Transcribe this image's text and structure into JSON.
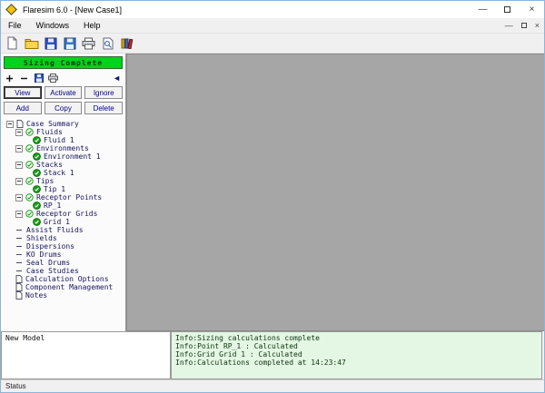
{
  "window": {
    "title": "Flaresim 6.0 - [New Case1]"
  },
  "menubar": {
    "items": [
      "File",
      "Windows",
      "Help"
    ]
  },
  "toolbar": {
    "icons": [
      "new-file",
      "open-folder",
      "save",
      "save-as",
      "print",
      "preview",
      "library"
    ]
  },
  "sidebar": {
    "status_banner": "Sizing Complete",
    "mini_toolbar": [
      "add",
      "remove",
      "save-mini",
      "print-mini"
    ],
    "collapse_arrow": "◄",
    "action_buttons": [
      "View",
      "Activate",
      "Ignore"
    ],
    "edit_buttons": [
      "Add",
      "Copy",
      "Delete"
    ],
    "tree": [
      {
        "label": "Case Summary",
        "level": 0,
        "icon": "doc",
        "expander": true
      },
      {
        "label": "Fluids",
        "level": 1,
        "icon": "check-open",
        "expander": true
      },
      {
        "label": "Fluid 1",
        "level": 2,
        "icon": "check-solid"
      },
      {
        "label": "Environments",
        "level": 1,
        "icon": "check-open",
        "expander": true
      },
      {
        "label": "Environment 1",
        "level": 2,
        "icon": "check-solid"
      },
      {
        "label": "Stacks",
        "level": 1,
        "icon": "check-open",
        "expander": true
      },
      {
        "label": "Stack 1",
        "level": 2,
        "icon": "check-solid"
      },
      {
        "label": "Tips",
        "level": 1,
        "icon": "check-open",
        "expander": true
      },
      {
        "label": "Tip 1",
        "level": 2,
        "icon": "check-solid"
      },
      {
        "label": "Receptor Points",
        "level": 1,
        "icon": "check-open",
        "expander": true
      },
      {
        "label": "RP_1",
        "level": 2,
        "icon": "check-solid"
      },
      {
        "label": "Receptor Grids",
        "level": 1,
        "icon": "check-open",
        "expander": true
      },
      {
        "label": "Grid 1",
        "level": 2,
        "icon": "check-solid"
      },
      {
        "label": "Assist Fluids",
        "level": 1,
        "icon": "dash"
      },
      {
        "label": "Shields",
        "level": 1,
        "icon": "dash"
      },
      {
        "label": "Dispersions",
        "level": 1,
        "icon": "dash"
      },
      {
        "label": "KO Drums",
        "level": 1,
        "icon": "dash"
      },
      {
        "label": "Seal Drums",
        "level": 1,
        "icon": "dash"
      },
      {
        "label": "Case Studies",
        "level": 1,
        "icon": "dash"
      },
      {
        "label": "Calculation Options",
        "level": 1,
        "icon": "doc"
      },
      {
        "label": "Component Management",
        "level": 1,
        "icon": "doc"
      },
      {
        "label": "Notes",
        "level": 1,
        "icon": "doc"
      }
    ]
  },
  "bottom": {
    "model_label": "New Model",
    "log_lines": [
      "Info:Sizing calculations complete",
      "Info:Point RP_1 : Calculated",
      "Info:Grid Grid 1  : Calculated",
      "Info:Calculations completed at 14:23:47"
    ]
  },
  "statusbar": {
    "label": "Status"
  },
  "colors": {
    "banner_green": "#00d21e",
    "log_background": "#e4f6e4",
    "workspace_gray": "#a6a6a6",
    "check_green": "#18a018",
    "button_text": "#000080"
  }
}
